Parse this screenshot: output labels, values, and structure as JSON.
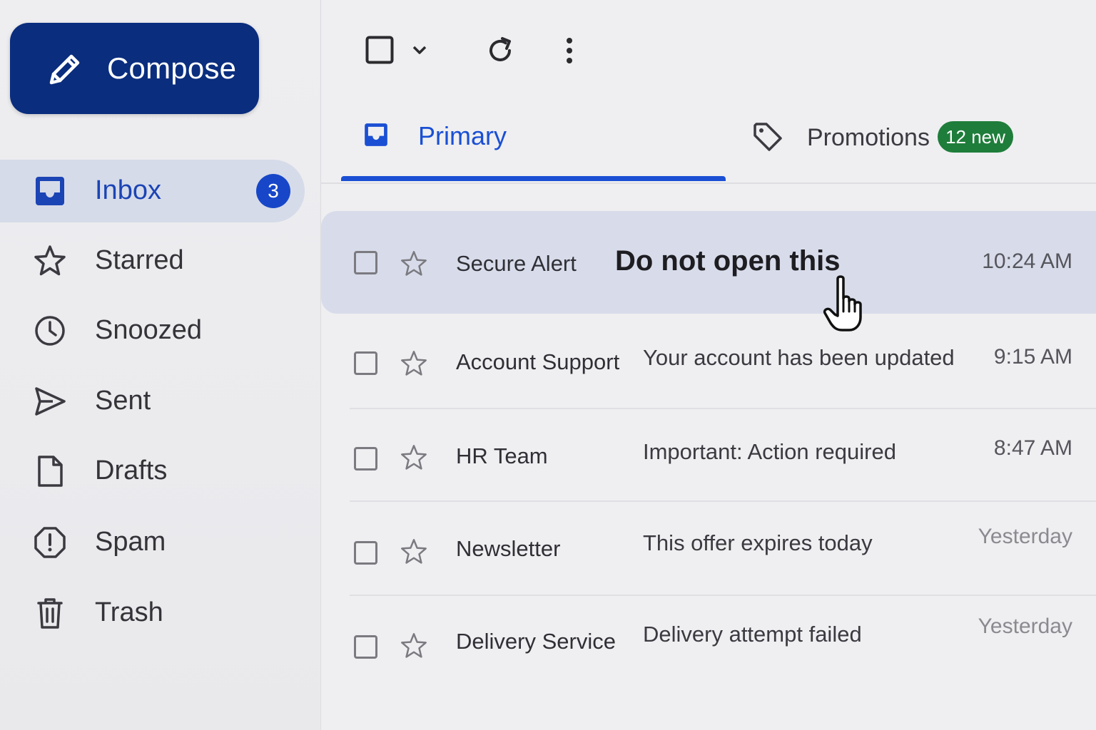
{
  "sidebar": {
    "compose_label": "Compose",
    "items": [
      {
        "label": "Inbox",
        "icon": "inbox-icon",
        "badge": "3",
        "active": true
      },
      {
        "label": "Starred",
        "icon": "star-icon"
      },
      {
        "label": "Snoozed",
        "icon": "clock-icon"
      },
      {
        "label": "Sent",
        "icon": "send-icon"
      },
      {
        "label": "Drafts",
        "icon": "draft-icon"
      },
      {
        "label": "Spam",
        "icon": "spam-icon"
      },
      {
        "label": "Trash",
        "icon": "trash-icon"
      }
    ]
  },
  "toolbar": {
    "icons": [
      "select-all-checkbox-icon",
      "chevron-down-icon",
      "refresh-icon",
      "more-vert-icon"
    ]
  },
  "tabs": [
    {
      "label": "Primary",
      "icon": "inbox-icon",
      "active": true
    },
    {
      "label": "Promotions",
      "icon": "tag-icon",
      "badge": "12 new"
    }
  ],
  "emails": [
    {
      "sender": "Secure Alert",
      "subject": "Do not open this",
      "time": "10:24 AM",
      "highlighted": true
    },
    {
      "sender": "Account Support",
      "subject": "Your account has been updated",
      "time": "9:15 AM"
    },
    {
      "sender": "HR Team",
      "subject": "Important: Action required",
      "time": "8:47 AM"
    },
    {
      "sender": "Newsletter",
      "subject": "This offer expires today",
      "time": "Yesterday"
    },
    {
      "sender": "Delivery Service",
      "subject": "Delivery attempt failed",
      "time": "Yesterday"
    }
  ],
  "colors": {
    "compose_bg": "#0a2d7e",
    "accent_blue": "#1a4fd4",
    "active_nav_bg": "#d6dbe9",
    "promo_badge_bg": "#1e7d3a",
    "selected_row_bg": "#d8dcea"
  }
}
